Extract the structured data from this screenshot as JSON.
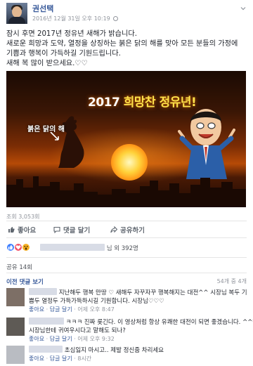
{
  "post": {
    "author": "권선택",
    "timestamp": "2016년 12월 31일 오후 10:19",
    "text_lines": [
      "잠시 후면 2017년 정유년 새해가 밝습니다.",
      "새로운 희망과 도약, 열정을 상징하는 붉은 닭의 해를 맞아 모든 분들의 가정에",
      "기쁨과 행복이 가득하길 기원드립니다.",
      "새해 복 많이 받으세요.♡♡"
    ],
    "image": {
      "headline_prefix": "2017 ",
      "headline_accent": "희망찬 정유년!",
      "rooster_label": "붉은 닭의 해"
    },
    "views": "조회 3,053회"
  },
  "actions": {
    "like": "좋아요",
    "comment": "댓글 달기",
    "share": "공유하기"
  },
  "reactions": {
    "summary_suffix": "님 외 392명"
  },
  "shares": "공유 14회",
  "comments_section": {
    "previous_link": "이전 댓글 보기",
    "count": "54개 중 4개"
  },
  "comments": [
    {
      "lines": [
        "지난해두 행복 만땅 ♡ 새해두 자꾸자꾸 행복해지는 대전^^ 시장님 복두 기",
        "쁨두 열정두 가득가득하시길 기원합니다. 시장님♡♡♡"
      ],
      "like": "좋아요",
      "reply": "답글 달기",
      "time": "어제 오후 8:47"
    },
    {
      "lines": [
        "ㅋㅋㅋ 진짜 롯긴다. 이 영상처럼 항상 유쾌한 대전이 되면 좋겠습니다. ^^*",
        "시장님한테 귀여우시다고 말해도 되나?"
      ],
      "like": "좋아요",
      "reply": "답글 달기",
      "time": "어제 오후 9:32"
    },
    {
      "lines": [
        "초심잃지 마시고.. 제발 정신줌 차리세요"
      ],
      "like": "좋아요",
      "reply": "답글 달기",
      "time": "8시간"
    }
  ],
  "colors": {
    "link": "#365899",
    "muted": "#90949c",
    "like_blue": "#4080ff",
    "love_red": "#f25268",
    "wow_yellow": "#f7b125"
  },
  "icons": [
    "globe-icon",
    "chevron-down-icon",
    "thumbs-up-icon",
    "comment-icon",
    "share-icon",
    "like-reaction-icon",
    "love-reaction-icon",
    "wow-reaction-icon"
  ]
}
